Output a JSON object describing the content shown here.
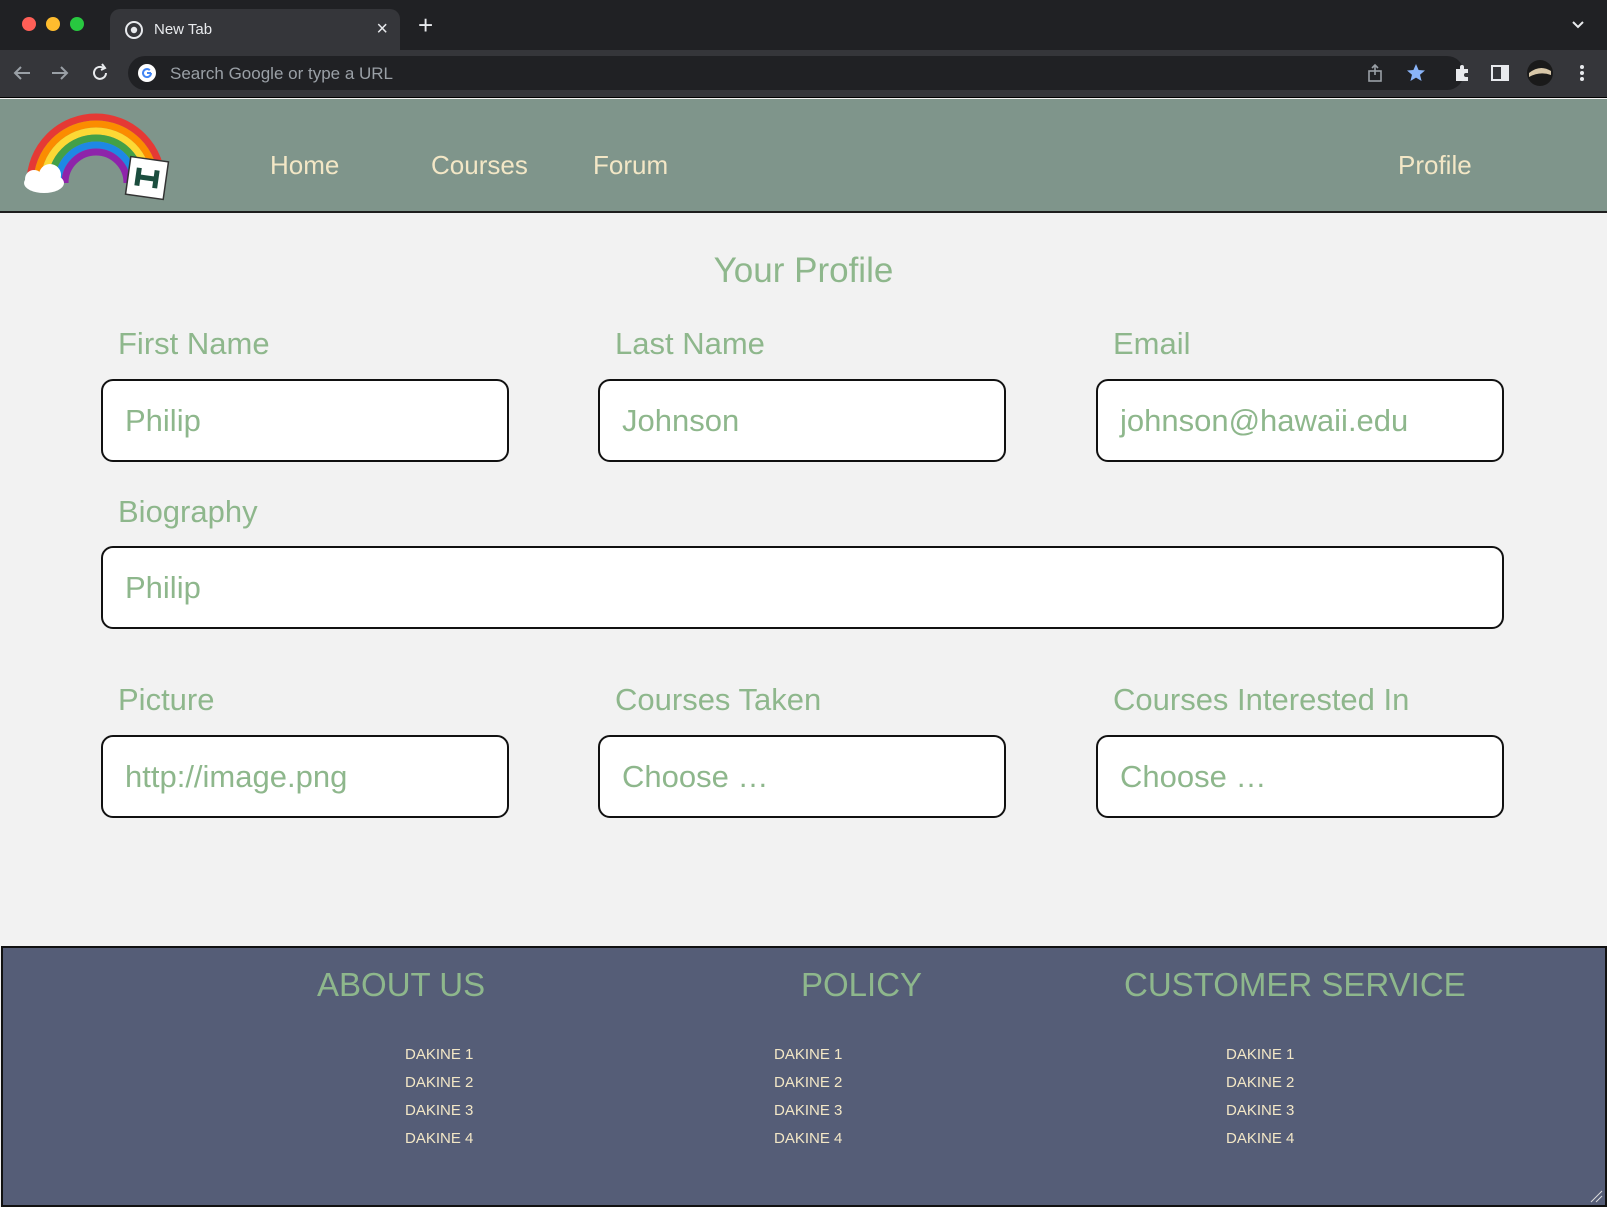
{
  "browser": {
    "tab_title": "New Tab",
    "tab_close": "×",
    "new_tab": "+",
    "address_placeholder": "Search Google or type a URL"
  },
  "navbar": {
    "links": [
      "Home",
      "Courses",
      "Forum"
    ],
    "profile": "Profile"
  },
  "page": {
    "title": "Your Profile",
    "fields": {
      "first_name": {
        "label": "First Name",
        "value": "Philip"
      },
      "last_name": {
        "label": "Last Name",
        "value": "Johnson"
      },
      "email": {
        "label": "Email",
        "value": "johnson@hawaii.edu"
      },
      "biography": {
        "label": "Biography",
        "value": "Philip"
      },
      "picture": {
        "label": "Picture",
        "value": "http://image.png"
      },
      "courses_taken": {
        "label": "Courses Taken",
        "value": "Choose …"
      },
      "courses_interested": {
        "label": "Courses Interested In",
        "value": "Choose …"
      }
    }
  },
  "footer": {
    "about": {
      "title": "ABOUT US",
      "links": [
        "DAKINE 1",
        "DAKINE 2",
        "DAKINE 3",
        "DAKINE 4"
      ]
    },
    "policy": {
      "title": "POLICY",
      "links": [
        "DAKINE 1",
        "DAKINE 2",
        "DAKINE 3",
        "DAKINE 4"
      ]
    },
    "service": {
      "title": "CUSTOMER SERVICE",
      "links": [
        "DAKINE 1",
        "DAKINE 2",
        "DAKINE 3",
        "DAKINE 4"
      ]
    }
  },
  "colors": {
    "navbar_bg": "#7f958b",
    "nav_text": "#f3e7c6",
    "accent_green": "#8eb78c",
    "footer_bg": "#555d77",
    "page_bg": "#f2f2f2"
  }
}
